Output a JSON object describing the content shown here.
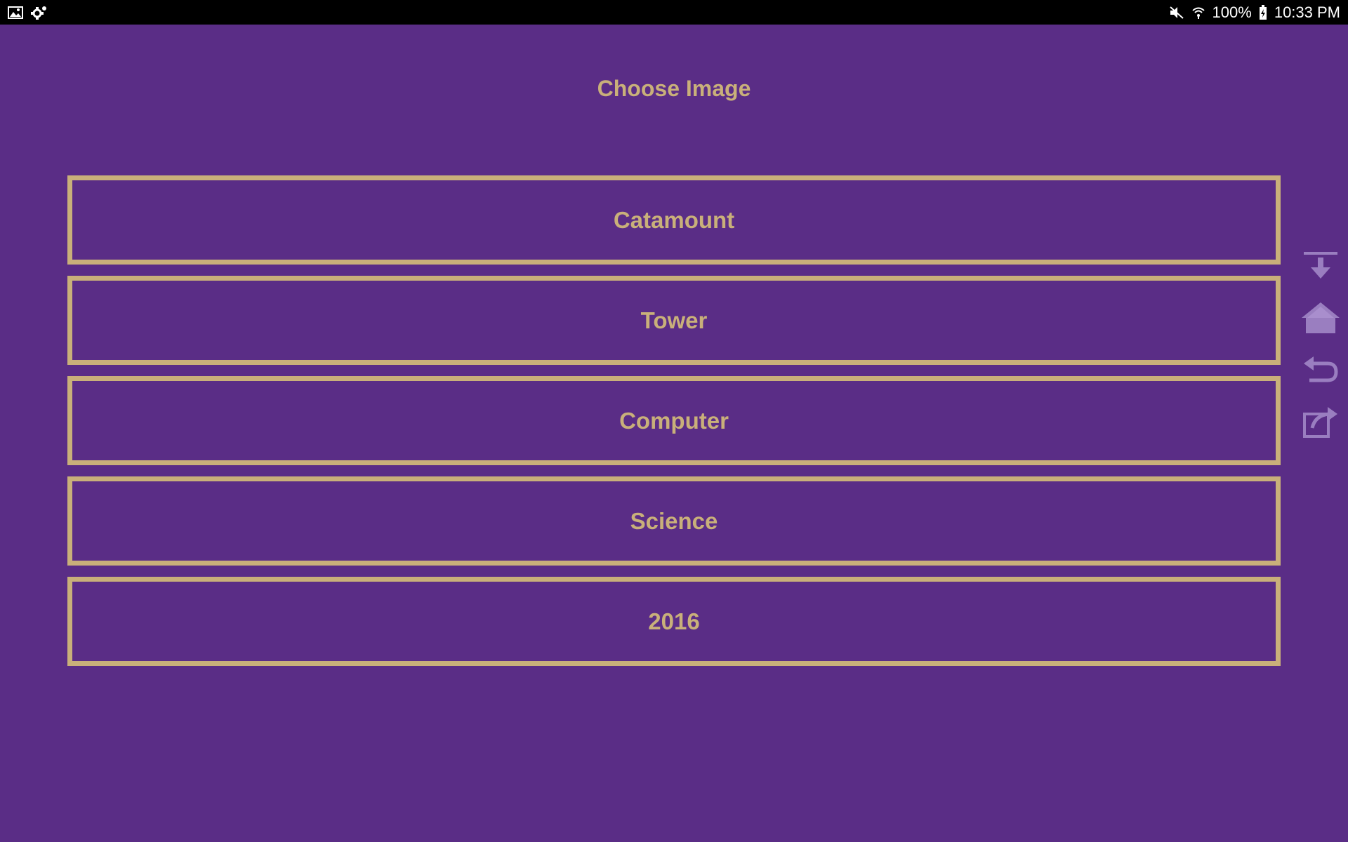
{
  "status_bar": {
    "left_icons": [
      "image-icon",
      "settings-gear-icon"
    ],
    "right_icons": [
      "mute-icon",
      "wifi-icon",
      "battery-charging-icon"
    ],
    "battery_percent": "100%",
    "time": "10:33 PM"
  },
  "page": {
    "title": "Choose Image",
    "options": [
      {
        "label": "Catamount"
      },
      {
        "label": "Tower"
      },
      {
        "label": "Computer"
      },
      {
        "label": "Science"
      },
      {
        "label": "2016"
      }
    ]
  },
  "side_toolbar": {
    "buttons": [
      "download-to-bottom-icon",
      "home-icon",
      "undo-icon",
      "share-icon"
    ]
  },
  "colors": {
    "background": "#5a2d86",
    "accent": "#c9b07a",
    "status_bar": "#000000",
    "toolbar_icon": "#9a7ec0"
  }
}
